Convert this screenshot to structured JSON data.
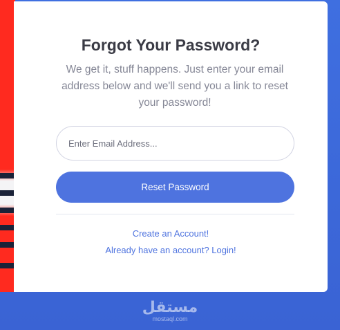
{
  "form": {
    "title": "Forgot Your Password?",
    "subtitle": "We get it, stuff happens. Just enter your email address below and we'll send you a link to reset your password!",
    "email_placeholder": "Enter Email Address...",
    "email_value": "",
    "reset_button_label": "Reset Password"
  },
  "links": {
    "create_account": "Create an Account!",
    "login": "Already have an account? Login!"
  },
  "watermark": {
    "main": "مستقل",
    "sub": "mostaql.com"
  },
  "colors": {
    "primary": "#4e73df",
    "background": "#3f6fe0",
    "card": "#ffffff",
    "text_dark": "#3a3b45",
    "text_muted": "#858796",
    "accent_red": "#ff2a1f"
  }
}
